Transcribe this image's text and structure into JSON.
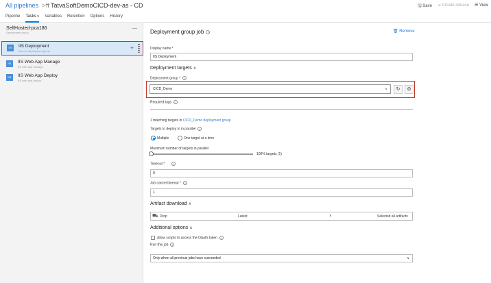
{
  "header": {
    "breadcrumb_link": "All pipelines",
    "breadcrumb_sep": ">",
    "pipeline_name": "TatvaSoftDemoCICD-dev-as - CD",
    "tabs": [
      {
        "label": "Pipeline"
      },
      {
        "label": "Tasks"
      },
      {
        "label": "Variables"
      },
      {
        "label": "Retention"
      },
      {
        "label": "Options"
      },
      {
        "label": "History"
      }
    ],
    "tasks_caret": "∨",
    "actions": {
      "save": "Save",
      "create_release": "Create release",
      "view": "View"
    }
  },
  "left": {
    "agent_title": "SelfHosted-pca186",
    "agent_sub": "Deployment group",
    "agent_menu": "—",
    "tasks": [
      {
        "title": "IIS Deployment",
        "sub": "Run on deployment group",
        "icon": "IIS"
      },
      {
        "title": "IIS Web App Manage",
        "sub": "IIS web app manage",
        "icon": "IIS"
      },
      {
        "title": "IIS Web App Deploy",
        "sub": "IIS web app deploy",
        "icon": "IIS"
      }
    ]
  },
  "right": {
    "job_title": "Deployment group job",
    "remove": "Remove",
    "display_name_label": "Display name *",
    "display_name_value": "IIS Deployment",
    "deployment_targets": "Deployment targets",
    "deployment_group_label": "Deployment group *",
    "deployment_group_value": "CICD_Demo",
    "required_tags_label": "Required tags",
    "matching_prefix": "1 matching targets in ",
    "matching_link": "CICD_Demo deployment group",
    "targets_parallel_label": "Targets to deploy to in parallel",
    "radio_multiple": "Multiple",
    "radio_one": "One target at a time",
    "max_targets_label": "Maximum number of targets in parallel",
    "slider_value_text": "100% targets (1)",
    "slider_level": 1.0,
    "timeout_label": "Timeout *",
    "timeout_value": "0",
    "cancel_timeout_label": "Job cancel timeout *",
    "cancel_timeout_value": "1",
    "artifact_download": "Artifact download",
    "artifact_name": "Drop",
    "artifact_version": "Latest",
    "artifact_selection": "Selected all artifacts",
    "additional_options": "Additional options",
    "allow_scripts": "Allow scripts to access the OAuth token",
    "run_this_job": "Run this job",
    "run_condition": "Only when all previous jobs have succeeded"
  },
  "colors": {
    "accent": "#0078d4",
    "highlight_border": "#c0392b",
    "link": "#2b7bd0"
  }
}
